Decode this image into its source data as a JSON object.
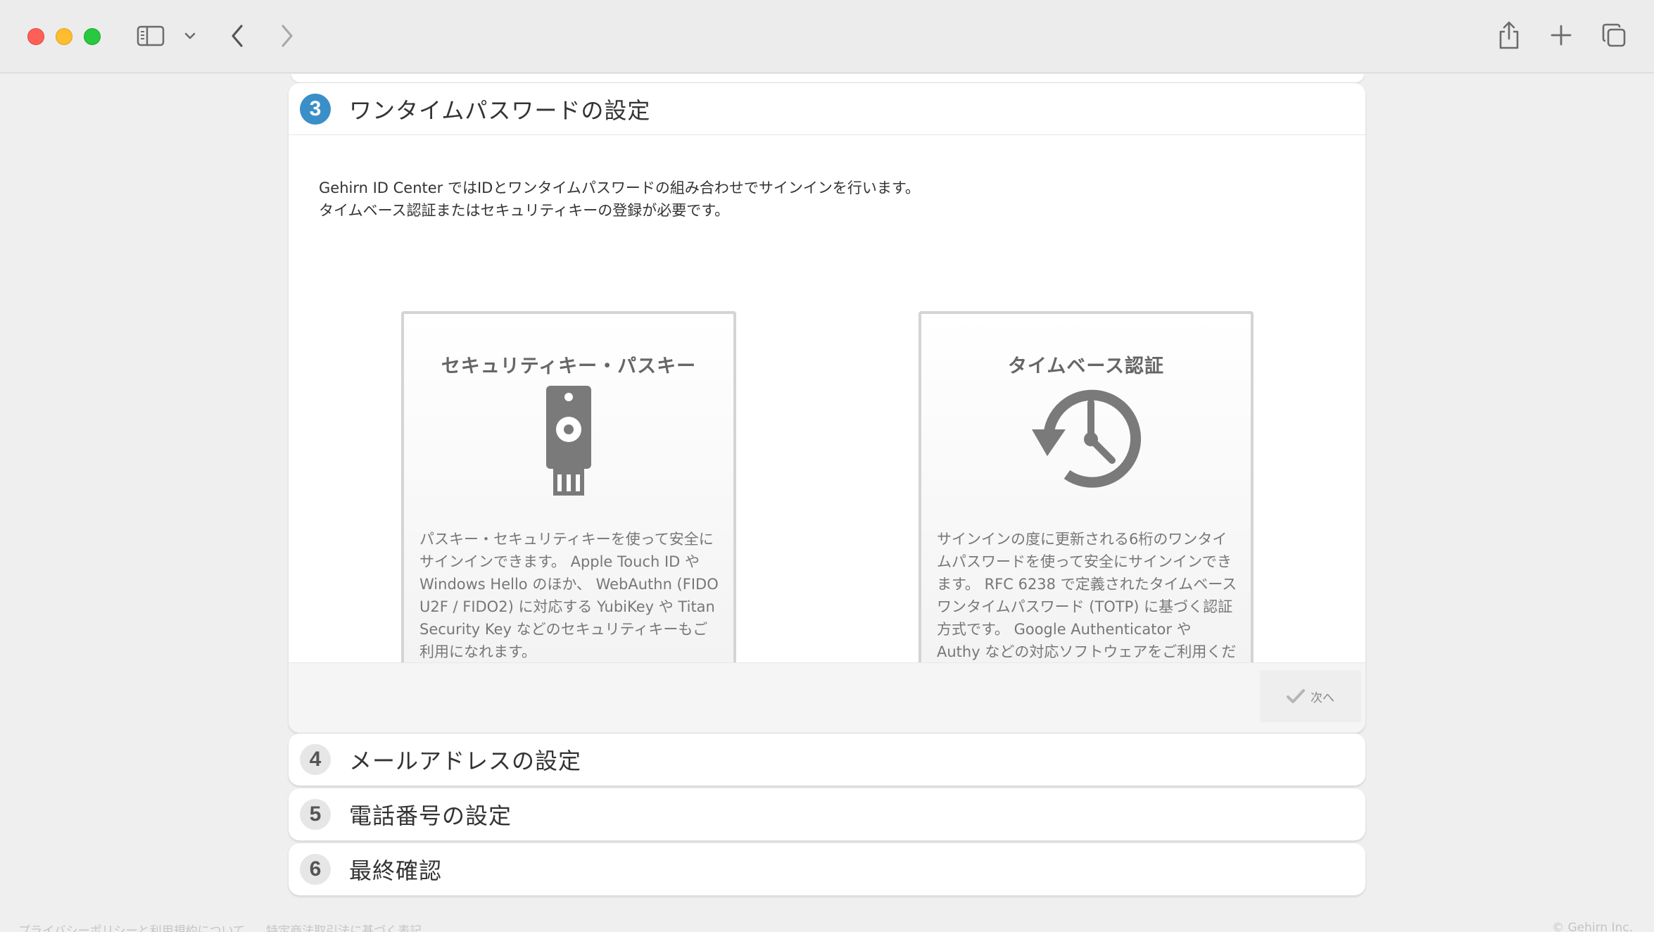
{
  "browser": {
    "icons": [
      "sidebar-icon",
      "chevron-down-icon",
      "back-icon",
      "forward-icon",
      "share-icon",
      "plus-icon",
      "tabs-overview-icon"
    ]
  },
  "steps": {
    "active": {
      "number": "3",
      "title": "ワンタイムパスワードの設定",
      "intro_line1": "Gehirn ID Center ではIDとワンタイムパスワードの組み合わせでサインインを行います。",
      "intro_line2": "タイムベース認証またはセキュリティキーの登録が必要です。",
      "options": {
        "passkey": {
          "title": "セキュリティキー・パスキー",
          "icon": "security-key-icon",
          "desc": "パスキー・セキュリティキーを使って安全にサインインできます。 Apple Touch ID や Windows Hello のほか、 WebAuthn (FIDO U2F / FIDO2) に対応する YubiKey や Titan Security Key などのセキュリティキーもご利用になれます。"
        },
        "totp": {
          "title": "タイムベース認証",
          "icon": "history-clock-icon",
          "desc": "サインインの度に更新される6桁のワンタイムパスワードを使って安全にサインインできます。 RFC 6238 で定義されたタイムベースワンタイムパスワード (TOTP) に基づく認証方式です。 Google Authenticator や Authy などの対応ソフトウェアをご利用ください。"
        }
      },
      "next_label": "次へ"
    },
    "step4": {
      "number": "4",
      "title": "メールアドレスの設定"
    },
    "step5": {
      "number": "5",
      "title": "電話番号の設定"
    },
    "step6": {
      "number": "6",
      "title": "最終確認"
    }
  },
  "footer": {
    "privacy_link": "プライバシーポリシーと利用規約について",
    "commerce_link": "特定商法取引法に基づく表記",
    "copyright": "© Gehirn Inc."
  },
  "colors": {
    "accent": "#3a8fc8",
    "page_bg": "#efefef",
    "card_bg": "#ffffff"
  }
}
